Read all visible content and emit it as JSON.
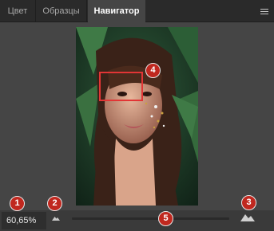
{
  "tabs": [
    {
      "label": "Цвет",
      "active": false
    },
    {
      "label": "Образцы",
      "active": false
    },
    {
      "label": "Навигатор",
      "active": true
    }
  ],
  "panel_menu_icon": "hamburger-menu-icon",
  "navigator": {
    "zoom_value": "60,65%",
    "zoom_slider_fraction": 0.45,
    "zoom_out_icon": "small-mountain-icon",
    "zoom_in_icon": "large-mountain-icon"
  },
  "annotations": [
    "1",
    "2",
    "3",
    "4",
    "5"
  ],
  "colors": {
    "tab_bar_bg": "#2a2a2a",
    "panel_bg": "#454545",
    "proxy_rect": "#e23535",
    "badge": "#c0281f"
  }
}
